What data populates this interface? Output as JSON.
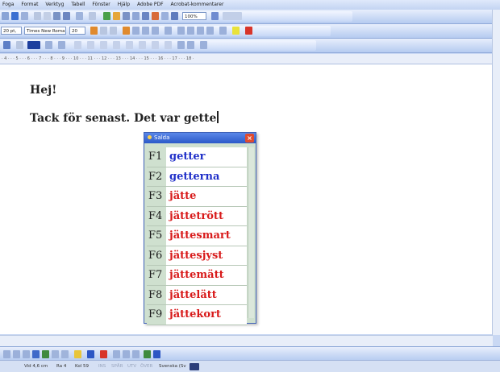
{
  "menubar": {
    "items": [
      "Fogа",
      "Format",
      "Verktyg",
      "Tabell",
      "Fönster",
      "Hjälp",
      "Adobe PDF",
      "Acrobat-kommentarer"
    ]
  },
  "toolbar_standard": {
    "zoom": "100%"
  },
  "toolbar_format": {
    "style": "20 pt,",
    "font": "Times New Roman",
    "size": "20"
  },
  "document": {
    "line1": "Hej!",
    "line2": "Tack för senast.  Det var gette"
  },
  "popup": {
    "title": "Salda",
    "close_icon": "close-icon",
    "suggestions": [
      {
        "key": "F1",
        "word": "getter",
        "color": "#1f2fc8"
      },
      {
        "key": "F2",
        "word": "getterna",
        "color": "#1f2fc8"
      },
      {
        "key": "F3",
        "word": "jätte",
        "color": "#d81a1a"
      },
      {
        "key": "F4",
        "word": "jättetrött",
        "color": "#d81a1a"
      },
      {
        "key": "F5",
        "word": "jättesmart",
        "color": "#d81a1a"
      },
      {
        "key": "F6",
        "word": "jättesjyst",
        "color": "#d81a1a"
      },
      {
        "key": "F7",
        "word": "jättemätt",
        "color": "#d81a1a"
      },
      {
        "key": "F8",
        "word": "jättelätt",
        "color": "#d81a1a"
      },
      {
        "key": "F9",
        "word": "jättekort",
        "color": "#d81a1a"
      }
    ]
  },
  "statusbar": {
    "position": "Vid 4,6 cm",
    "row": "Ra 4",
    "col": "Kol 59",
    "inactive": [
      "INS",
      "SPÅR",
      "UTV",
      "ÖVER"
    ],
    "language": "Svenska (Sv"
  }
}
